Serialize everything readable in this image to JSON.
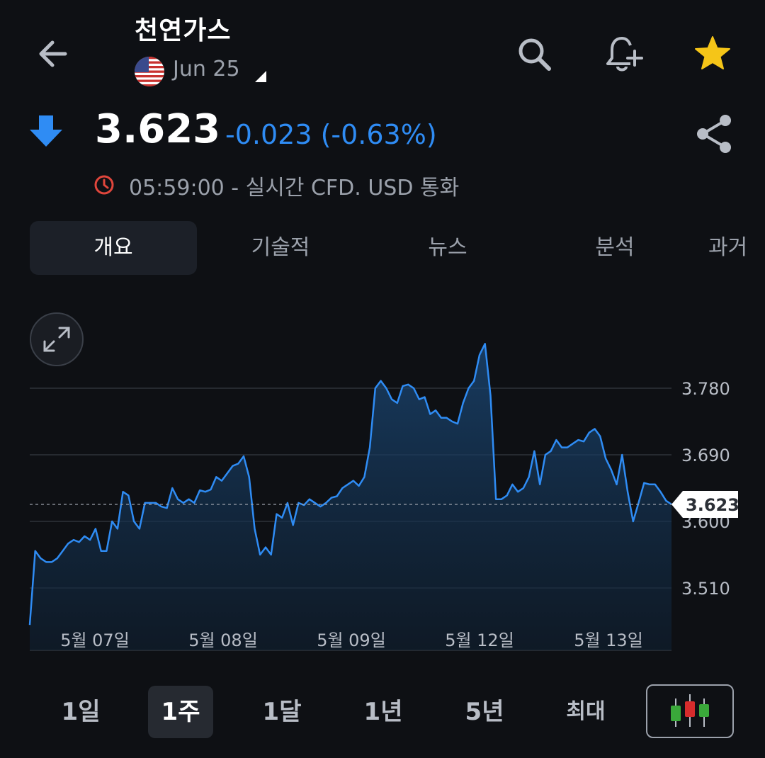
{
  "header": {
    "title": "천연가스",
    "contract": "Jun 25"
  },
  "quote": {
    "price": "3.623",
    "change": "-0.023 (-0.63%)",
    "direction": "down",
    "realtime_text": "05:59:00 - 실시간 CFD. USD 통화",
    "change_color": "#2f8cf4"
  },
  "tabs": [
    {
      "label": "개요",
      "active": true
    },
    {
      "label": "기술적",
      "active": false
    },
    {
      "label": "뉴스",
      "active": false
    },
    {
      "label": "분석",
      "active": false
    },
    {
      "label": "과거",
      "active": false
    }
  ],
  "chart_data": {
    "type": "area",
    "x_ticks": [
      "5월 07일",
      "5월 08일",
      "5월 09일",
      "5월 12일",
      "5월 13일"
    ],
    "y_ticks": [
      "3.780",
      "3.690",
      "3.600",
      "3.510"
    ],
    "ylim": [
      3.455,
      3.79
    ],
    "current_label": "3.623",
    "current_value": 3.623,
    "grid": true,
    "line_color": "#2f8cf4",
    "values": [
      3.46,
      3.56,
      3.55,
      3.545,
      3.545,
      3.55,
      3.56,
      3.57,
      3.575,
      3.572,
      3.58,
      3.575,
      3.59,
      3.56,
      3.56,
      3.6,
      3.59,
      3.64,
      3.635,
      3.6,
      3.59,
      3.625,
      3.625,
      3.625,
      3.62,
      3.618,
      3.645,
      3.63,
      3.625,
      3.63,
      3.625,
      3.642,
      3.64,
      3.643,
      3.66,
      3.655,
      3.665,
      3.675,
      3.678,
      3.688,
      3.66,
      3.59,
      3.555,
      3.565,
      3.555,
      3.61,
      3.605,
      3.625,
      3.595,
      3.625,
      3.622,
      3.63,
      3.625,
      3.62,
      3.625,
      3.632,
      3.634,
      3.645,
      3.65,
      3.655,
      3.648,
      3.66,
      3.7,
      3.78,
      3.79,
      3.78,
      3.765,
      3.76,
      3.783,
      3.785,
      3.78,
      3.765,
      3.768,
      3.745,
      3.75,
      3.74,
      3.74,
      3.735,
      3.732,
      3.76,
      3.78,
      3.79,
      3.825,
      3.84,
      3.77,
      3.63,
      3.63,
      3.635,
      3.65,
      3.64,
      3.645,
      3.66,
      3.695,
      3.65,
      3.69,
      3.695,
      3.71,
      3.7,
      3.7,
      3.705,
      3.71,
      3.708,
      3.72,
      3.725,
      3.715,
      3.685,
      3.67,
      3.65,
      3.69,
      3.64,
      3.6,
      3.625,
      3.652,
      3.65,
      3.65,
      3.64,
      3.628,
      3.623
    ]
  },
  "ranges": [
    {
      "label": "1일",
      "active": false
    },
    {
      "label": "1주",
      "active": true
    },
    {
      "label": "1달",
      "active": false
    },
    {
      "label": "1년",
      "active": false
    },
    {
      "label": "5년",
      "active": false
    },
    {
      "label": "최대",
      "active": false
    }
  ],
  "icons": {
    "back": "arrow-left-icon",
    "search": "search-icon",
    "alert": "bell-plus-icon",
    "favorite": "star-icon",
    "share": "share-icon",
    "clock": "clock-icon",
    "expand": "expand-icon",
    "candles": "candlestick-icon"
  },
  "colors": {
    "background": "#0e1014",
    "accent": "#2f8cf4",
    "star": "#f5c518",
    "clock": "#e0463c"
  }
}
